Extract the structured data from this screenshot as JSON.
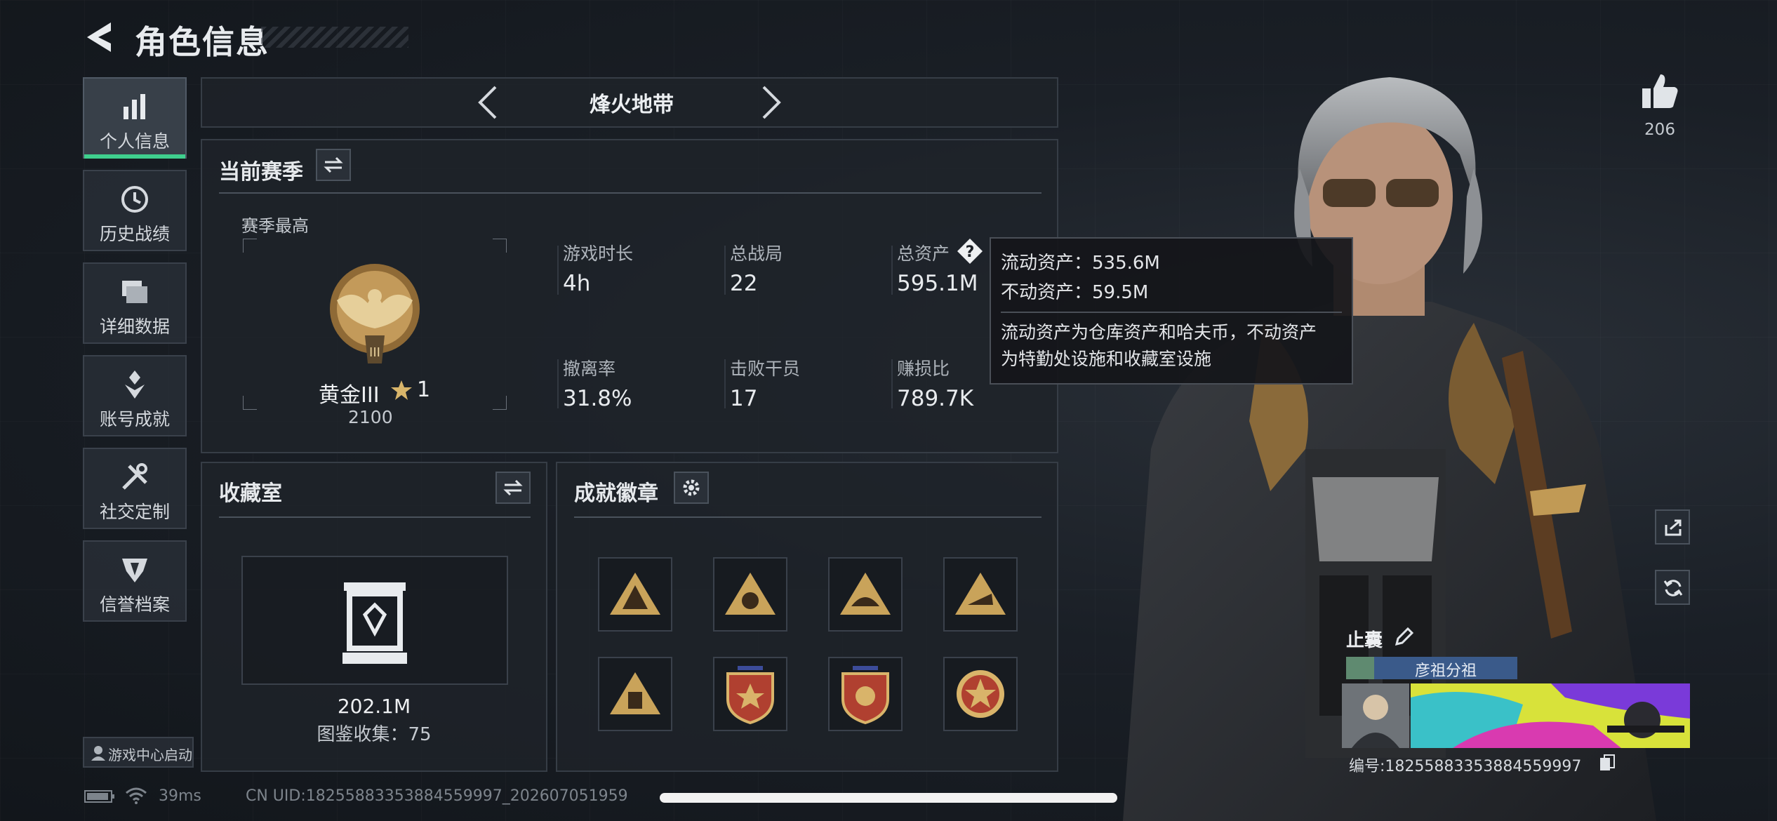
{
  "header": {
    "title": "角色信息"
  },
  "nav": {
    "items": [
      {
        "label": "个人信息",
        "icon": "bar-chart-icon",
        "active": true
      },
      {
        "label": "历史战绩",
        "icon": "history-clock-icon"
      },
      {
        "label": "详细数据",
        "icon": "folder-stack-icon"
      },
      {
        "label": "账号成就",
        "icon": "achievement-medal-icon"
      },
      {
        "label": "社交定制",
        "icon": "tools-wrench-icon"
      },
      {
        "label": "信誉档案",
        "icon": "shield-emblem-icon"
      }
    ],
    "launch_label": "游戏中心启动"
  },
  "mode_selector": {
    "label": "烽火地带"
  },
  "season": {
    "title": "当前赛季",
    "peak_label": "赛季最高",
    "rank_name": "黄金III",
    "rank_stars": "1",
    "rank_points": "2100",
    "stats": [
      {
        "label": "游戏时长",
        "value": "4h"
      },
      {
        "label": "总战局",
        "value": "22"
      },
      {
        "label": "总资产",
        "value": "595.1M"
      },
      {
        "label": "撤离率",
        "value": "31.8%"
      },
      {
        "label": "击败干员",
        "value": "17"
      },
      {
        "label": "赚损比",
        "value": "789.7K"
      }
    ]
  },
  "tooltip": {
    "liquid": "流动资产：535.6M",
    "fixed": "不动资产：59.5M",
    "desc_line1": "流动资产为仓库资产和哈夫币，不动资产",
    "desc_line2": "为特勤处设施和收藏室设施"
  },
  "collection": {
    "title": "收藏室",
    "value": "202.1M",
    "count_text": "图鉴收集：75"
  },
  "achievements": {
    "title": "成就徽章",
    "badges": [
      {
        "icon": "triangle-badge-icon",
        "color": "#c9a35a"
      },
      {
        "icon": "triangle-badge-icon",
        "color": "#c9a35a"
      },
      {
        "icon": "triangle-badge-icon",
        "color": "#c9a35a"
      },
      {
        "icon": "triangle-badge-icon",
        "color": "#c9a35a"
      },
      {
        "icon": "triangle-badge-icon",
        "color": "#c9a35a"
      },
      {
        "icon": "shield-star-badge-icon",
        "color": "#b04030"
      },
      {
        "icon": "shield-star-badge-icon",
        "color": "#b04030"
      },
      {
        "icon": "round-star-badge-icon",
        "color": "#b04030"
      }
    ]
  },
  "likes": {
    "count": "206"
  },
  "profile": {
    "name": "止囊",
    "team": "彦祖分祖",
    "id_text": "编号:18255883353884559997"
  },
  "status_bar": {
    "ping": "39ms",
    "uid": "CN UID:18255883353884559997_202607051959"
  }
}
